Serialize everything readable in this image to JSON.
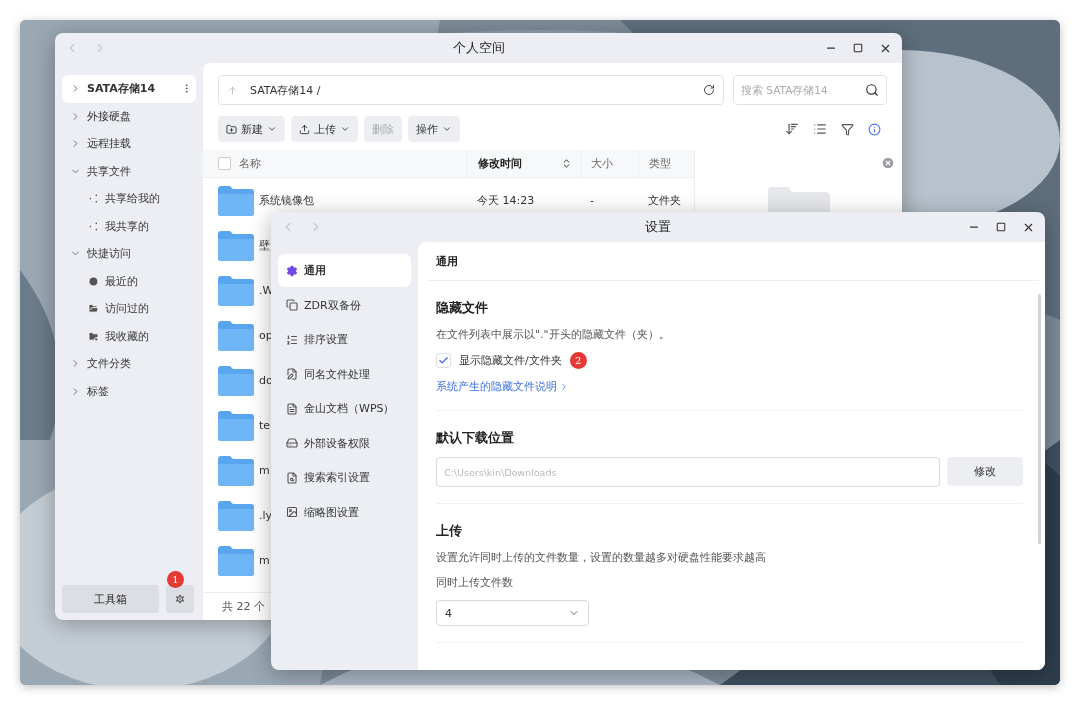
{
  "main_window": {
    "title": "个人空间",
    "sidebar": {
      "items": [
        {
          "label": "SATA存储14",
          "selected": true,
          "expanded": false
        },
        {
          "label": "外接硬盘",
          "selected": false,
          "expanded": false
        },
        {
          "label": "远程挂载",
          "selected": false,
          "expanded": false
        },
        {
          "label": "共享文件",
          "selected": false,
          "expanded": true,
          "children": [
            {
              "kind": "share",
              "label": "共享给我的",
              "selected": false
            },
            {
              "kind": "share",
              "label": "我共享的",
              "selected": false
            }
          ]
        },
        {
          "label": "快捷访问",
          "selected": false,
          "expanded": true,
          "children": [
            {
              "kind": "recent",
              "label": "最近的",
              "selected": false
            },
            {
              "kind": "visited",
              "label": "访问过的",
              "selected": false
            },
            {
              "kind": "favorite",
              "label": "我收藏的",
              "selected": false
            }
          ]
        },
        {
          "label": "文件分类",
          "selected": false,
          "expanded": false
        },
        {
          "label": "标签",
          "selected": false,
          "expanded": false
        }
      ],
      "toolbox_button": "工具箱",
      "settings_badge": "1"
    },
    "path_bar": {
      "path": "SATA存储14 /"
    },
    "search": {
      "placeholder": "搜索 SATA存储14"
    },
    "toolbar": [
      {
        "kind": "new",
        "label": "新建",
        "dropdown": true,
        "disabled": false
      },
      {
        "kind": "upload",
        "label": "上传",
        "dropdown": true,
        "disabled": false
      },
      {
        "kind": "plain",
        "label": "删除",
        "dropdown": false,
        "disabled": true
      },
      {
        "kind": "plain",
        "label": "操作",
        "dropdown": true,
        "disabled": false
      }
    ],
    "table": {
      "columns": [
        {
          "label": "名称",
          "sorted": false
        },
        {
          "label": "修改时间",
          "sorted": true
        },
        {
          "label": "大小",
          "sorted": false
        },
        {
          "label": "类型",
          "sorted": false
        }
      ],
      "rows": [
        {
          "name": "系统镜像包",
          "modified": "今天 14:23",
          "size": "-",
          "type": "文件夹"
        },
        {
          "name": "壁"
        },
        {
          "name": ".W"
        },
        {
          "name": "op"
        },
        {
          "name": "do"
        },
        {
          "name": "te"
        },
        {
          "name": "m"
        },
        {
          "name": ".ly"
        },
        {
          "name": "m"
        }
      ]
    },
    "footer": "共 22 个"
  },
  "settings_window": {
    "title": "设置",
    "nav": [
      {
        "kind": "general",
        "label": "通用",
        "selected": true
      },
      {
        "kind": "backup",
        "label": "ZDR双备份",
        "selected": false
      },
      {
        "kind": "sort",
        "label": "排序设置",
        "selected": false
      },
      {
        "kind": "rename",
        "label": "同名文件处理",
        "selected": false
      },
      {
        "kind": "document",
        "label": "金山文档（WPS）",
        "selected": false
      },
      {
        "kind": "device",
        "label": "外部设备权限",
        "selected": false
      },
      {
        "kind": "index",
        "label": "搜索索引设置",
        "selected": false
      },
      {
        "kind": "thumbnail",
        "label": "缩略图设置",
        "selected": false
      }
    ],
    "panel_title": "通用",
    "hidden_files": {
      "title": "隐藏文件",
      "description": "在文件列表中展示以\".\"开头的隐藏文件（夹）。",
      "checkbox": {
        "label": "显示隐藏文件/文件夹",
        "checked": true
      },
      "badge": "2",
      "link": "系统产生的隐藏文件说明"
    },
    "download_location": {
      "title": "默认下载位置",
      "field": {
        "placeholder": "C:\\Users\\kin\\Downloads"
      },
      "button": "修改"
    },
    "upload": {
      "title": "上传",
      "description": "设置允许同时上传的文件数量，设置的数量越多对硬盘性能要求越高",
      "field_label": "同时上传文件数",
      "select": {
        "value": "4"
      }
    }
  }
}
